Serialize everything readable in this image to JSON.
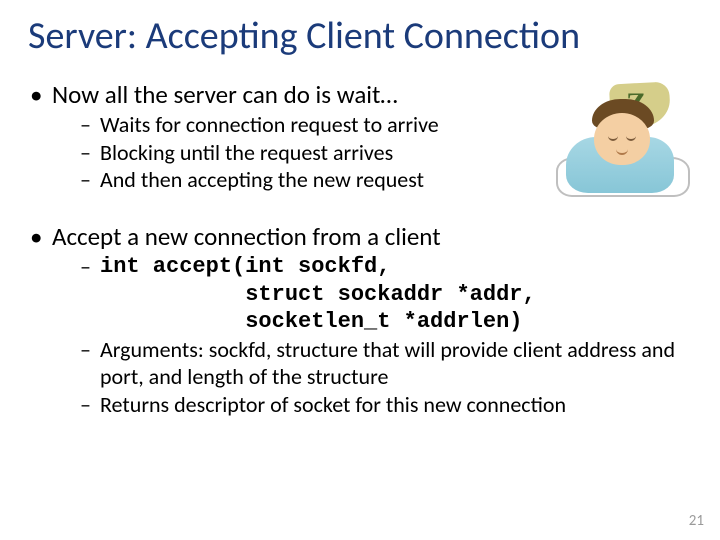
{
  "title": "Server: Accepting Client Connection",
  "section1": {
    "lead": "Now all the server can do is wait…",
    "items": [
      "Waits for connection request to arrive",
      "Blocking until the request arrives",
      "And then accepting the new request"
    ]
  },
  "section2": {
    "lead": "Accept a new connection from a client",
    "code1": "int accept(int sockfd,",
    "code2": "           struct sockaddr *addr,",
    "code3": "           socketlen_t *addrlen)",
    "items": [
      "Arguments: sockfd, structure that will provide client address and port, and length of the structure",
      "Returns descriptor of socket for this new connection"
    ]
  },
  "slide_number": "21",
  "illustration": {
    "z_text": "Z"
  }
}
